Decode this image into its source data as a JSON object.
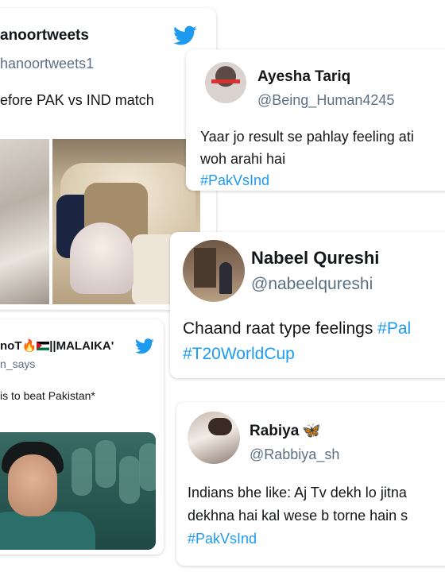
{
  "colors": {
    "accent": "#1d9bf0",
    "handle": "#5b7083"
  },
  "tweet1": {
    "name": "anoortweets",
    "handle": "hanoortweets1",
    "text": "efore PAK vs IND match"
  },
  "tweet2": {
    "name": "Ayesha Tariq",
    "handle": "@Being_Human4245",
    "line1": "Yaar jo result se pahlay feeling ati",
    "line2": "woh arahi hai",
    "hashtag": "#PakVsInd",
    "avatar_badge": "Free Palestine"
  },
  "tweet3": {
    "name": "Nabeel Qureshi",
    "handle": "@nabeelqureshi",
    "line1_text": "Chaand raat type feelings ",
    "line1_tag": "#Pal",
    "hashtag2": "#T20WorldCup"
  },
  "tweet4": {
    "name_a": "noT",
    "name_b": "||MALAIKA'",
    "handle": "n_says",
    "text": "is to beat Pakistan*"
  },
  "tweet5": {
    "name": "Rabiya",
    "handle": "@Rabbiya_sh",
    "line1": "Indians bhe like: Aj Tv dekh lo jitna",
    "line2": "dekhna hai kal wese b torne hain s",
    "hashtag": "#PakVsInd"
  },
  "icons": {
    "bird": "twitter-bird-icon",
    "fire": "fire-emoji",
    "flag": "palestine-flag-emoji",
    "butterfly": "butterfly-emoji"
  }
}
